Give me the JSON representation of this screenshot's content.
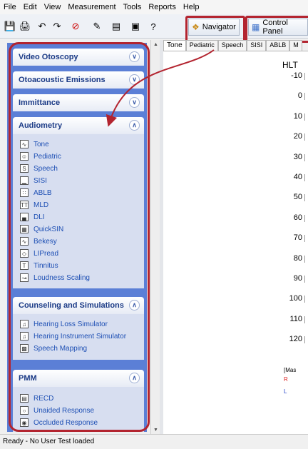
{
  "menu": [
    "File",
    "Edit",
    "View",
    "Measurement",
    "Tools",
    "Reports",
    "Help"
  ],
  "toolbar": {
    "icons": [
      "save-icon",
      "print-icon",
      "undo-icon",
      "redo-icon",
      "no-icon",
      "edit-icon",
      "book-icon",
      "monitor-icon",
      "help-icon"
    ],
    "navigator_label": "Navigator",
    "control_panel_label": "Control Panel"
  },
  "nav_groups": {
    "video_otoscopy": "Video Otoscopy",
    "oae": "Otoacoustic Emissions",
    "immittance": "Immittance",
    "audiometry": "Audiometry",
    "counseling": "Counseling and Simulations",
    "pmm": "PMM"
  },
  "audiometry_items": [
    "Tone",
    "Pediatric",
    "Speech",
    "SISI",
    "ABLB",
    "MLD",
    "DLI",
    "QuickSIN",
    "Bekesy",
    "LIPread",
    "Tinnitus",
    "Loudness Scaling"
  ],
  "counseling_items": [
    "Hearing Loss Simulator",
    "Hearing Instrument Simulator",
    "Speech Mapping"
  ],
  "pmm_items": [
    "RECD",
    "Unaided Response",
    "Occluded Response"
  ],
  "tabs": [
    "Tone",
    "Pediatric",
    "Speech",
    "SISI",
    "ABLB",
    "M"
  ],
  "chart": {
    "unit": "HLT",
    "levels": [
      "-10",
      "0",
      "10",
      "20",
      "30",
      "40",
      "50",
      "60",
      "70",
      "80",
      "90",
      "100",
      "110",
      "120"
    ],
    "legend_title": "[Mas",
    "legend_r": "R",
    "legend_l": "L"
  },
  "status": "Ready - No User Test loaded"
}
